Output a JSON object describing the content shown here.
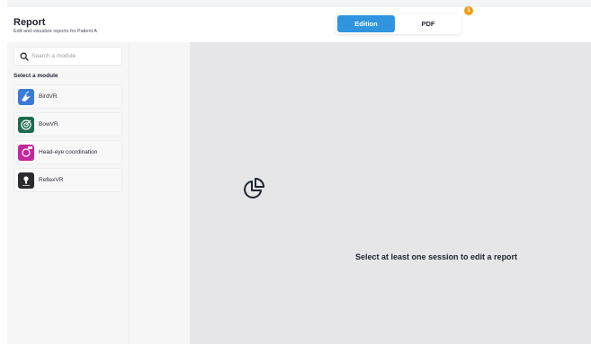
{
  "header": {
    "title": "Report",
    "subtitle": "Edit and visualize reports for Patient A",
    "toggle": {
      "edition_label": "Edition",
      "pdf_label": "PDF",
      "active": "Edition"
    },
    "badge_count": "1"
  },
  "sidebar": {
    "search_placeholder": "Search a module",
    "section_label": "Select a module",
    "modules": [
      {
        "label": "BirdVR",
        "icon": "bird-icon",
        "color": "#3a7bd5"
      },
      {
        "label": "BowVR",
        "icon": "target-icon",
        "color": "#1f6b4f"
      },
      {
        "label": "Head-eye coordination",
        "icon": "eye-icon",
        "color": "#c2279b"
      },
      {
        "label": "ReflexVR",
        "icon": "bulb-icon",
        "color": "#2b2b2f"
      }
    ]
  },
  "main": {
    "empty_icon": "pie-chart-icon",
    "empty_message": "Select at least one session to edit a report"
  },
  "colors": {
    "accent": "#2f95df",
    "badge": "#f39c12",
    "main_bg": "#e6e6e9"
  }
}
